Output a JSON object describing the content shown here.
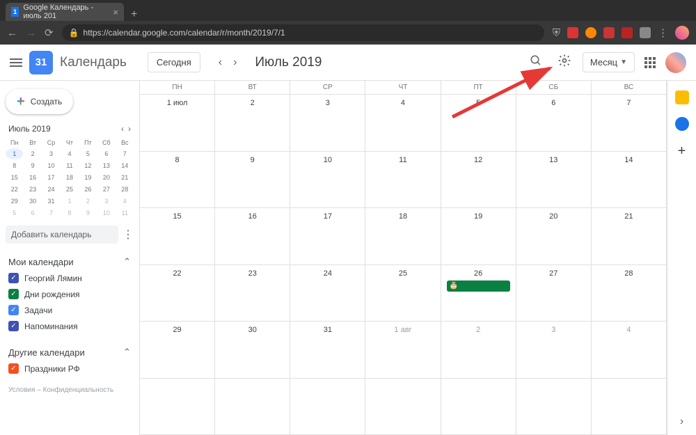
{
  "browser": {
    "tab_title": "Google Календарь - июль 201",
    "favicon_text": "1",
    "url": "https://calendar.google.com/calendar/r/month/2019/7/1"
  },
  "header": {
    "logo_text": "31",
    "app_name": "Календарь",
    "today_btn": "Сегодня",
    "month_title": "Июль 2019",
    "view_label": "Месяц"
  },
  "sidebar": {
    "create_label": "Создать",
    "mini_month": "Июль 2019",
    "mini_days": [
      "Пн",
      "Вт",
      "Ср",
      "Чт",
      "Пт",
      "Сб",
      "Вс"
    ],
    "mini_cells": [
      {
        "n": "1",
        "t": true
      },
      {
        "n": "2"
      },
      {
        "n": "3"
      },
      {
        "n": "4"
      },
      {
        "n": "5"
      },
      {
        "n": "6"
      },
      {
        "n": "7"
      },
      {
        "n": "8"
      },
      {
        "n": "9"
      },
      {
        "n": "10"
      },
      {
        "n": "11"
      },
      {
        "n": "12"
      },
      {
        "n": "13"
      },
      {
        "n": "14"
      },
      {
        "n": "15"
      },
      {
        "n": "16"
      },
      {
        "n": "17"
      },
      {
        "n": "18"
      },
      {
        "n": "19"
      },
      {
        "n": "20"
      },
      {
        "n": "21"
      },
      {
        "n": "22"
      },
      {
        "n": "23"
      },
      {
        "n": "24"
      },
      {
        "n": "25"
      },
      {
        "n": "26"
      },
      {
        "n": "27"
      },
      {
        "n": "28"
      },
      {
        "n": "29"
      },
      {
        "n": "30"
      },
      {
        "n": "31"
      },
      {
        "n": "1",
        "o": true
      },
      {
        "n": "2",
        "o": true
      },
      {
        "n": "3",
        "o": true
      },
      {
        "n": "4",
        "o": true
      },
      {
        "n": "5",
        "o": true
      },
      {
        "n": "6",
        "o": true
      },
      {
        "n": "7",
        "o": true
      },
      {
        "n": "8",
        "o": true
      },
      {
        "n": "9",
        "o": true
      },
      {
        "n": "10",
        "o": true
      },
      {
        "n": "11",
        "o": true
      }
    ],
    "add_calendar_placeholder": "Добавить календарь",
    "my_calendars_label": "Мои календари",
    "my_calendars": [
      {
        "label": "Георгий Лямин",
        "color": "#3f51b5"
      },
      {
        "label": "Дни рождения",
        "color": "#0b8043"
      },
      {
        "label": "Задачи",
        "color": "#4285f4"
      },
      {
        "label": "Напоминания",
        "color": "#3f51b5"
      }
    ],
    "other_calendars_label": "Другие календари",
    "other_calendars": [
      {
        "label": "Праздники РФ",
        "color": "#f4511e"
      }
    ],
    "footer": "Условия – Конфиденциальность"
  },
  "calendar": {
    "day_headers": [
      "ПН",
      "ВТ",
      "СР",
      "ЧТ",
      "ПТ",
      "СБ",
      "ВС"
    ],
    "weeks": [
      [
        {
          "n": "1 июл"
        },
        {
          "n": "2"
        },
        {
          "n": "3"
        },
        {
          "n": "4"
        },
        {
          "n": "5"
        },
        {
          "n": "6"
        },
        {
          "n": "7"
        }
      ],
      [
        {
          "n": "8"
        },
        {
          "n": "9"
        },
        {
          "n": "10"
        },
        {
          "n": "11"
        },
        {
          "n": "12"
        },
        {
          "n": "13"
        },
        {
          "n": "14"
        }
      ],
      [
        {
          "n": "15"
        },
        {
          "n": "16"
        },
        {
          "n": "17"
        },
        {
          "n": "18"
        },
        {
          "n": "19"
        },
        {
          "n": "20"
        },
        {
          "n": "21"
        }
      ],
      [
        {
          "n": "22"
        },
        {
          "n": "23"
        },
        {
          "n": "24"
        },
        {
          "n": "25"
        },
        {
          "n": "26",
          "event": true
        },
        {
          "n": "27"
        },
        {
          "n": "28"
        }
      ],
      [
        {
          "n": "29"
        },
        {
          "n": "30"
        },
        {
          "n": "31"
        },
        {
          "n": "1 авг",
          "o": true
        },
        {
          "n": "2",
          "o": true
        },
        {
          "n": "3",
          "o": true
        },
        {
          "n": "4",
          "o": true
        }
      ],
      [
        {
          "n": "",
          "o": true
        },
        {
          "n": "",
          "o": true
        },
        {
          "n": "",
          "o": true
        },
        {
          "n": "",
          "o": true
        },
        {
          "n": "",
          "o": true
        },
        {
          "n": "",
          "o": true
        },
        {
          "n": "",
          "o": true
        }
      ]
    ]
  },
  "colors": {
    "keep_icon": "#fbbc04",
    "tasks_icon": "#1a73e8"
  }
}
